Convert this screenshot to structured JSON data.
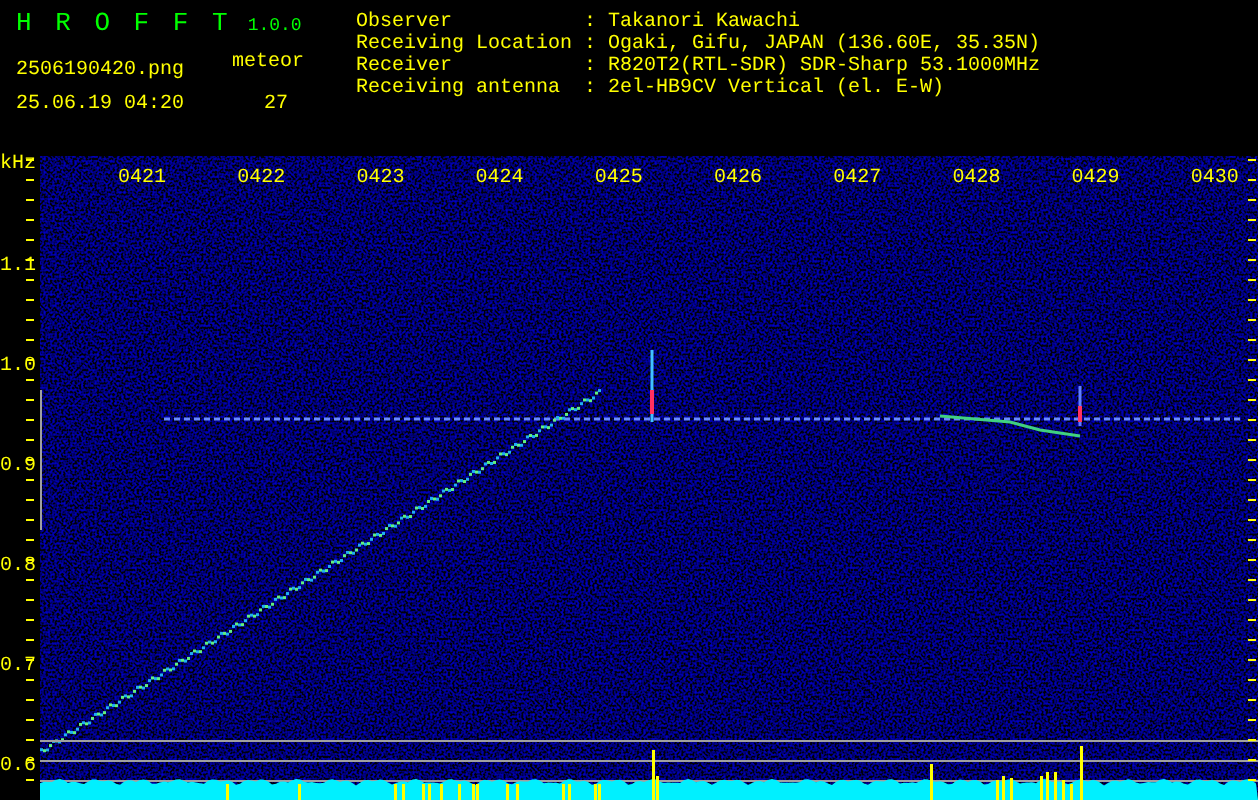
{
  "header": {
    "app_title": "H R O F F T",
    "version": "1.0.0",
    "file_name": "2506190420.png",
    "timestamp": "25.06.19 04:20",
    "meteor_label": "meteor",
    "meteor_count": "27"
  },
  "station_info": [
    {
      "label": "Observer",
      "separator": ":",
      "value": "Takanori Kawachi"
    },
    {
      "label": "Receiving Location",
      "separator": ":",
      "value": "Ogaki, Gifu, JAPAN (136.60E, 35.35N)"
    },
    {
      "label": "Receiver",
      "separator": ":",
      "value": "R820T2(RTL-SDR) SDR-Sharp 53.1000MHz"
    },
    {
      "label": "Receiving antenna",
      "separator": ":",
      "value": "2el-HB9CV Vertical (el. E-W)"
    }
  ],
  "spectrogram": {
    "y_unit": "kHz",
    "time_labels": [
      "0421",
      "0422",
      "0423",
      "0424",
      "0425",
      "0426",
      "0427",
      "0428",
      "0429",
      "0430"
    ],
    "frequency_labels": [
      "1.1",
      "1.0",
      "0.9",
      "0.8",
      "0.7",
      "0.6"
    ]
  }
}
